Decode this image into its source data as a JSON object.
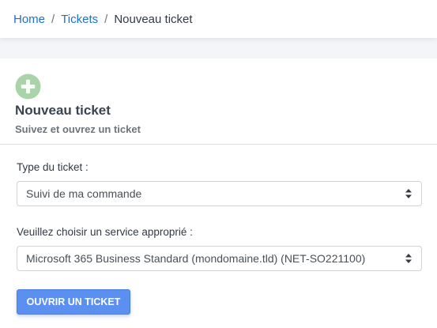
{
  "breadcrumb": {
    "items": [
      "Home",
      "Tickets"
    ],
    "separator": "/",
    "current": "Nouveau ticket"
  },
  "header": {
    "icon": "plus-circle-icon",
    "title": "Nouveau ticket",
    "subtitle": "Suivez et ouvrez un ticket"
  },
  "form": {
    "type_label": "Type du ticket :",
    "type_value": "Suivi de ma commande",
    "service_label": "Veuillez choisir un service approprié :",
    "service_value": "Microsoft 365 Business Standard (mondomaine.tld) (NET-SO221100)",
    "submit_label": "OUVRIR UN TICKET"
  },
  "colors": {
    "link": "#1f6fd1",
    "icon": "#9fcf9f",
    "button": "#5b8ff0"
  }
}
